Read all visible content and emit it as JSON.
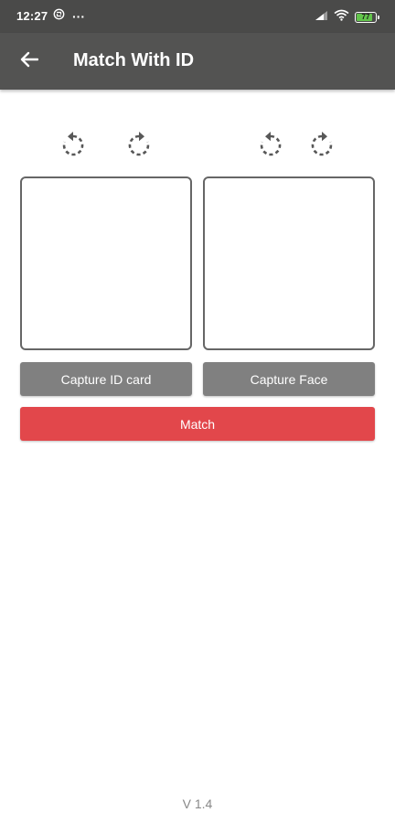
{
  "status_bar": {
    "time": "12:27",
    "more_indicator": "···",
    "battery_level": "77",
    "icons": [
      "sync-icon",
      "signal-icon",
      "wifi-icon",
      "battery-icon"
    ],
    "battery_color": "#62c44b"
  },
  "app_bar": {
    "title": "Match With ID",
    "back_icon": "arrow-left-icon",
    "background_color": "#535352"
  },
  "id_panel": {
    "rotate_icons": [
      "rotate-left-icon",
      "rotate-right-icon"
    ],
    "capture_label": "Capture ID card"
  },
  "face_panel": {
    "rotate_icons": [
      "rotate-left-icon",
      "rotate-right-icon"
    ],
    "capture_label": "Capture Face"
  },
  "match_button": {
    "label": "Match",
    "color": "#e2474b"
  },
  "footer": {
    "version": "V 1.4"
  }
}
